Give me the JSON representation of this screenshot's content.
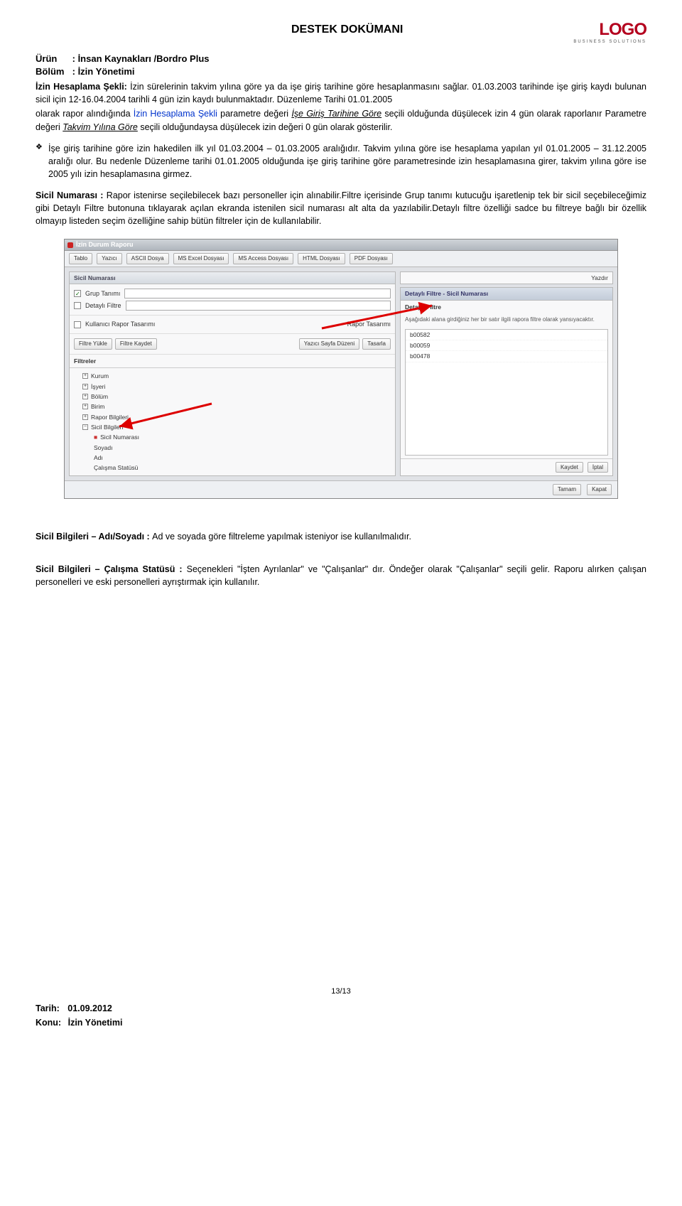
{
  "header": {
    "title": "DESTEK DOKÜMANI",
    "logo_text": "LOGO",
    "logo_sub": "BUSINESS SOLUTIONS"
  },
  "meta": {
    "urun_label": "Ürün",
    "urun_value": ": İnsan Kaynakları /Bordro Plus",
    "bolum_label": "Bölüm",
    "bolum_value": ": İzin Yönetimi"
  },
  "para1": {
    "lead_bold": "İzin Hesaplama Şekli:",
    "rest": " İzin sürelerinin takvim yılına göre ya da işe giriş tarihine göre hesaplanmasını sağlar. 01.03.2003 tarihinde işe giriş kaydı bulunan sicil için 12-16.04.2004 tarihli 4 gün izin kaydı bulunmaktadır. Düzenleme Tarihi 01.01.2005"
  },
  "para2": {
    "t1": "olarak rapor alındığında  ",
    "blue": "İzin Hesaplama Şekli",
    "t2": " parametre değeri ",
    "u1": "İşe Giriş Tarihine Göre",
    "t3": " seçili olduğunda düşülecek izin 4 gün olarak raporlanır Parametre değeri ",
    "u2": "Takvim Yılına Göre",
    "t4": " seçili olduğundaysa düşülecek izin değeri 0 gün olarak gösterilir."
  },
  "bullet": "İşe giriş tarihine göre izin hakedilen ilk yıl 01.03.2004 – 01.03.2005 aralığıdır. Takvim yılına göre ise hesaplama yapılan yıl 01.01.2005 – 31.12.2005 aralığı olur. Bu nedenle Düzenleme tarihi 01.01.2005 olduğunda işe giriş tarihine göre parametresinde izin hesaplamasına girer, takvim yılına göre ise 2005 yılı izin hesaplamasına girmez.",
  "sicil_numarasi": {
    "label": "Sicil Numarası : ",
    "text": "Rapor istenirse seçilebilecek bazı personeller için alınabilir.Filtre içerisinde Grup tanımı kutucuğu işaretlenip tek bir sicil seçebileceğimiz gibi Detaylı Filtre butonuna tıklayarak açılan ekranda istenilen sicil numarası alt alta da yazılabilir.Detaylı filtre özelliği sadce bu filtreye bağlı bir özellik olmayıp listeden seçim özelliğine sahip bütün filtreler için de kullanılabilir."
  },
  "sicil_adsoyad": {
    "label": "Sicil Bilgileri – Adı/Soyadı : ",
    "text": "Ad ve soyada göre filtreleme yapılmak isteniyor ise kullanılmalıdır."
  },
  "sicil_statu": {
    "label": "Sicil Bilgileri – Çalışma Statüsü : ",
    "text": "Seçenekleri \"İşten Ayrılanlar\" ve \"Çalışanlar\" dır. Öndeğer olarak \"Çalışanlar\" seçili gelir. Raporu alırken çalışan personelleri ve eski personelleri ayrıştırmak için kullanılır."
  },
  "screenshot": {
    "win_title": "İzin Durum Raporu",
    "toolbar": [
      "Tablo",
      "Yazıcı",
      "ASCII Dosya",
      "MS Excel Dosyası",
      "MS Access Dosyası",
      "HTML Dosyası",
      "PDF Dosyası"
    ],
    "left_panel_title": "Sicil Numarası",
    "grup_tanimi": "Grup Tanımı",
    "detayli_filtre": "Detaylı Filtre",
    "kr_tasarim": "Kullanıcı Rapor Tasarımı",
    "rapor_tasarim": "Rapor Tasarımı",
    "filtre_yukle": "Filtre Yükle",
    "filtre_kaydet": "Filtre Kaydet",
    "yazici_sayfa": "Yazıcı Sayfa Düzeni",
    "tasarla": "Tasarla",
    "filtreler_label": "Filtreler",
    "tree": [
      "Kurum",
      "İşyeri",
      "Bölüm",
      "Birim",
      "Rapor Bilgileri",
      "Sicil Bilgileri"
    ],
    "tree_sub": "Sicil Numarası",
    "tree_after": [
      "Soyadı",
      "Adı",
      "Çalışma Statüsü"
    ],
    "yazdir": "Yazdır",
    "detay_title": "Detaylı Filtre - Sicil Numarası",
    "detay_bold": "Detaylı Filtre",
    "detay_desc": "Aşağıdaki alana girdiğiniz her bir satır ilgili rapora filtre olarak yansıyacaktır.",
    "list_items": [
      "b00582",
      "b00059",
      "b00478"
    ],
    "kaydet": "Kaydet",
    "iptal": "İptal",
    "tamam": "Tamam",
    "kapat": "Kapat"
  },
  "footer": {
    "page_num": "13/13",
    "tarih_label": "Tarih:",
    "tarih_value": "01.09.2012",
    "konu_label": "Konu:",
    "konu_value": "İzin Yönetimi"
  }
}
